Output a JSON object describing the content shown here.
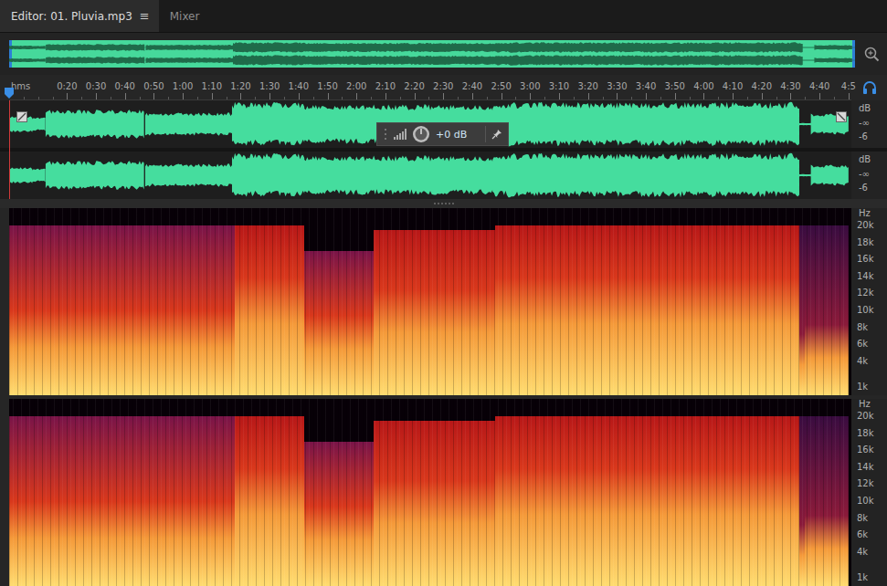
{
  "window": {
    "title": "Editor: 01. Pluvia.mp3"
  },
  "tabs": [
    {
      "label": "Editor: 01. Pluvia.mp3",
      "selected": true,
      "menu": "≡"
    },
    {
      "label": "Mixer",
      "selected": false
    }
  ],
  "overview": {
    "viewStart": 0,
    "viewEnd": 291
  },
  "timeline": {
    "unit": "hms",
    "duration": 291,
    "playhead": 0,
    "ticks": [
      {
        "label": "0:20",
        "seconds": 20
      },
      {
        "label": "0:30",
        "seconds": 30
      },
      {
        "label": "0:40",
        "seconds": 40
      },
      {
        "label": "0:50",
        "seconds": 50
      },
      {
        "label": "1:00",
        "seconds": 60
      },
      {
        "label": "1:10",
        "seconds": 70
      },
      {
        "label": "1:20",
        "seconds": 80
      },
      {
        "label": "1:30",
        "seconds": 90
      },
      {
        "label": "1:40",
        "seconds": 100
      },
      {
        "label": "1:50",
        "seconds": 110
      },
      {
        "label": "2:00",
        "seconds": 120
      },
      {
        "label": "2:10",
        "seconds": 130
      },
      {
        "label": "2:20",
        "seconds": 140
      },
      {
        "label": "2:30",
        "seconds": 150
      },
      {
        "label": "2:40",
        "seconds": 160
      },
      {
        "label": "2:50",
        "seconds": 170
      },
      {
        "label": "3:00",
        "seconds": 180
      },
      {
        "label": "3:10",
        "seconds": 190
      },
      {
        "label": "3:20",
        "seconds": 200
      },
      {
        "label": "3:30",
        "seconds": 210
      },
      {
        "label": "3:40",
        "seconds": 220
      },
      {
        "label": "3:50",
        "seconds": 230
      },
      {
        "label": "4:00",
        "seconds": 240
      },
      {
        "label": "4:10",
        "seconds": 250
      },
      {
        "label": "4:20",
        "seconds": 260
      },
      {
        "label": "4:30",
        "seconds": 270
      },
      {
        "label": "4:40",
        "seconds": 280
      },
      {
        "label": "4:5",
        "seconds": 290
      }
    ]
  },
  "hud": {
    "gain": "+0 dB"
  },
  "waveform": {
    "channels": [
      {
        "unit": "dB",
        "marks": [
          "-∞",
          "-6"
        ]
      },
      {
        "unit": "dB",
        "marks": [
          "-∞",
          "-6"
        ]
      }
    ],
    "segments": [
      {
        "start": 0,
        "end": 8,
        "level": 0.35
      },
      {
        "start": 8,
        "end": 12.6,
        "level": 0.3
      },
      {
        "start": 12.6,
        "end": 47,
        "level": 0.62
      },
      {
        "start": 47,
        "end": 77,
        "level": 0.5
      },
      {
        "start": 77,
        "end": 102,
        "level": 0.95
      },
      {
        "start": 102,
        "end": 167,
        "level": 0.85
      },
      {
        "start": 167,
        "end": 273,
        "level": 0.95
      },
      {
        "start": 273,
        "end": 277,
        "level": 0.05
      },
      {
        "start": 277,
        "end": 290,
        "level": 0.45
      }
    ]
  },
  "spectrogram": {
    "maxHz": 22050,
    "channels": [
      {
        "unit": "Hz"
      },
      {
        "unit": "Hz"
      }
    ],
    "ticks": [
      {
        "label": "20k",
        "hz": 20000
      },
      {
        "label": "18k",
        "hz": 18000
      },
      {
        "label": "16k",
        "hz": 16000
      },
      {
        "label": "14k",
        "hz": 14000
      },
      {
        "label": "12k",
        "hz": 12000
      },
      {
        "label": "10k",
        "hz": 10000
      },
      {
        "label": "8k",
        "hz": 8000
      },
      {
        "label": "6k",
        "hz": 6000
      },
      {
        "label": "4k",
        "hz": 4000
      },
      {
        "label": "1k",
        "hz": 1000
      }
    ],
    "segments": [
      {
        "start": 0,
        "end": 78,
        "intensity": 0.45,
        "cutoffHz": 20000
      },
      {
        "start": 78,
        "end": 102,
        "intensity": 0.8,
        "cutoffHz": 20000
      },
      {
        "start": 102,
        "end": 126,
        "intensity": 0.55,
        "cutoffHz": 17000
      },
      {
        "start": 126,
        "end": 168,
        "intensity": 0.7,
        "cutoffHz": 19500
      },
      {
        "start": 168,
        "end": 273,
        "intensity": 0.8,
        "cutoffHz": 20000
      },
      {
        "start": 273,
        "end": 275,
        "intensity": 0.2,
        "cutoffHz": 20000
      },
      {
        "start": 275,
        "end": 290,
        "intensity": 0.3,
        "cutoffHz": 20000
      },
      {
        "start": 290,
        "end": 291,
        "intensity": 0,
        "cutoffHz": 0
      }
    ]
  }
}
